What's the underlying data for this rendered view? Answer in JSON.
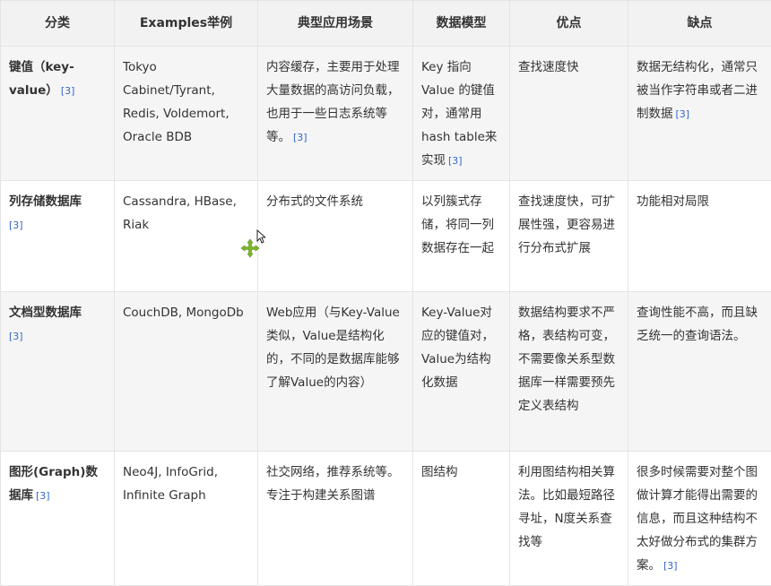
{
  "columns": [
    "分类",
    "Examples举例",
    "典型应用场景",
    "数据模型",
    "优点",
    "缺点"
  ],
  "rows": [
    {
      "category": "键值（key-value）",
      "examples": "Tokyo Cabinet/Tyrant, Redis, Voldemort, Oracle BDB",
      "scenario": "内容缓存，主要用于处理大量数据的高访问负载，也用于一些日志系统等等。",
      "scenario_ref": "[3]",
      "model": "Key 指向 Value 的键值对，通常用hash table来实现",
      "model_ref": "[3]",
      "pros": "查找速度快",
      "cons": "数据无结构化，通常只被当作字符串或者二进制数据",
      "cons_ref": "[3]",
      "category_ref": "[3]"
    },
    {
      "category": "列存储数据库",
      "category_ref": "[3]",
      "examples": "Cassandra, HBase, Riak",
      "scenario": "分布式的文件系统",
      "model": "以列簇式存储，将同一列数据存在一起",
      "pros": "查找速度快，可扩展性强，更容易进行分布式扩展",
      "cons": "功能相对局限"
    },
    {
      "category": "文档型数据库",
      "category_ref": "[3]",
      "examples": "CouchDB, MongoDb",
      "scenario": "Web应用（与Key-Value类似，Value是结构化的，不同的是数据库能够了解Value的内容）",
      "model": "Key-Value对应的键值对，Value为结构化数据",
      "pros": "数据结构要求不严格，表结构可变，不需要像关系型数据库一样需要预先定义表结构",
      "cons": "查询性能不高，而且缺乏统一的查询语法。"
    },
    {
      "category": "图形(Graph)数据库",
      "category_ref": "[3]",
      "examples": "Neo4J, InfoGrid, Infinite Graph",
      "scenario": "社交网络，推荐系统等。专注于构建关系图谱",
      "model": "图结构",
      "pros": "利用图结构相关算法。比如最短路径寻址，N度关系查找等",
      "cons": "很多时候需要对整个图做计算才能得出需要的信息，而且这种结构不太好做分布式的集群方案。",
      "cons_ref": "[3]"
    }
  ],
  "icons": {
    "cursor": "mouse-pointer-icon",
    "move": "move-cross-icon"
  }
}
